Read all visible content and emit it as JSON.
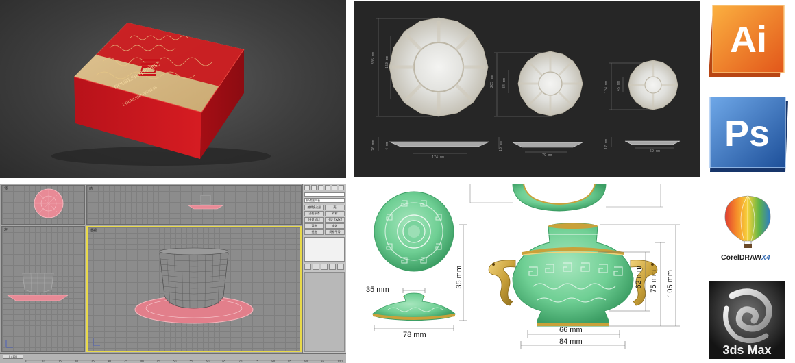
{
  "gift_box": {
    "lid_text": "DOUBLEHAPPINESS",
    "side_text": "DOUBLEHAPPINESS",
    "colors": {
      "red": "#c8141b",
      "gold": "#d2b27a",
      "background": "#434343"
    }
  },
  "plate_drawing": {
    "plates": [
      {
        "height_label": "305 mm",
        "inner_label": "160 mm",
        "width_label": "174 mm",
        "depth_label": "26 mm",
        "inner_depth_label": "4 mm"
      },
      {
        "height_label": "205 mm",
        "inner_label": "84 mm",
        "width_label": "79 mm",
        "depth_label": "15 mm"
      },
      {
        "height_label": "124 mm",
        "inner_label": "45 mm",
        "width_label": "59 mm",
        "depth_label": "17 mm"
      }
    ]
  },
  "max_ui": {
    "viewports": [
      {
        "label": "顶"
      },
      {
        "label": "前"
      },
      {
        "label": "左"
      },
      {
        "label": "透视"
      }
    ],
    "command_panel": {
      "dropdown": "修改器列表",
      "buttons": [
        "编辑多边形",
        "壳",
        "涡轮平滑",
        "对称",
        "FFD 3x3",
        "FFD 2x2x2",
        "弯曲",
        "噪波",
        "扭曲",
        "网格平滑"
      ]
    },
    "timeline": {
      "frame_readout": "0 / 100",
      "ticks": [
        "0",
        "10",
        "15",
        "20",
        "25",
        "30",
        "35",
        "40",
        "45",
        "50",
        "55",
        "60",
        "65",
        "70",
        "75",
        "80",
        "85",
        "90",
        "95",
        "100"
      ]
    },
    "colors": {
      "viewport": "#8c8c8c",
      "active_border": "#e8d94a",
      "mesh_pink": "#e88a96"
    }
  },
  "pot_drawing": {
    "dimensions": {
      "lid_top": "35 mm",
      "lid_height": "35 mm",
      "lid_width": "78 mm",
      "body_62": "62 mm",
      "body_75": "75 mm",
      "body_105": "105 mm",
      "base_66": "66 mm",
      "base_84": "84 mm"
    },
    "colors": {
      "jade": "#6fcf94",
      "jade_dark": "#3c9e64",
      "gold": "#c9a13a"
    }
  },
  "logos": {
    "illustrator": {
      "label": "Ai",
      "color": "#f7941d"
    },
    "photoshop": {
      "label": "Ps",
      "color": "#2f6fbf"
    },
    "coreldraw": {
      "name": "CorelDRAW",
      "version": "X4"
    },
    "max": {
      "name": "3ds Max"
    }
  }
}
